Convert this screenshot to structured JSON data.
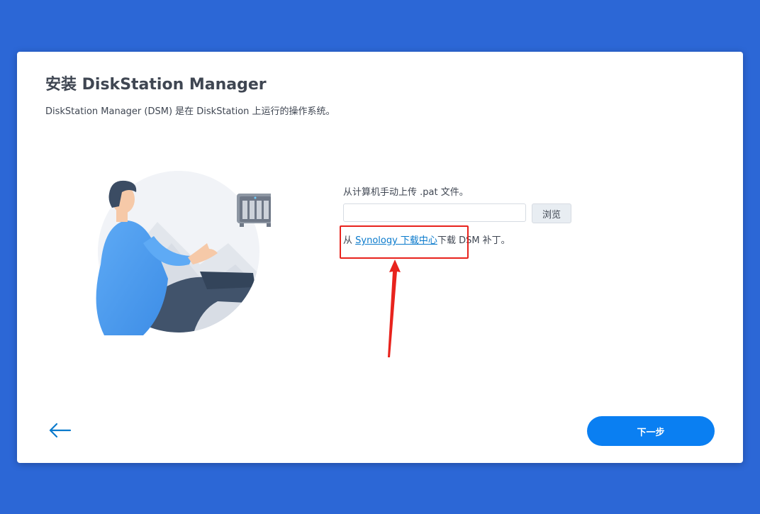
{
  "dialog": {
    "title": "安装 DiskStation Manager",
    "subtitle": "DiskStation Manager (DSM) 是在 DiskStation 上运行的操作系统。"
  },
  "upload": {
    "label": "从计算机手动上传 .pat 文件。",
    "file_value": "",
    "browse_label": "浏览"
  },
  "download": {
    "prefix": "从 ",
    "link_text": "Synology 下载中心",
    "suffix": "下载 DSM 补丁。"
  },
  "footer": {
    "back_icon": "arrow-left-icon",
    "next_label": "下一步"
  },
  "colors": {
    "background": "#2c67d6",
    "accent": "#0a7ff2",
    "link": "#0a7acc",
    "annotation": "#e8231d"
  }
}
